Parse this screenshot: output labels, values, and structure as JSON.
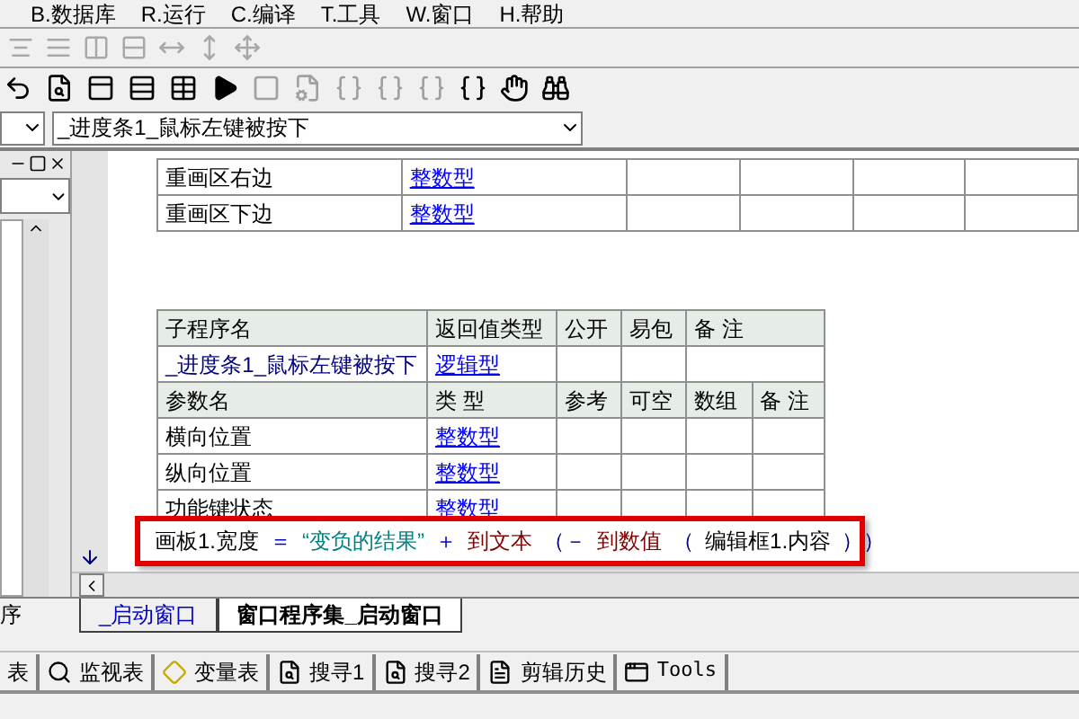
{
  "menu": [
    "B.数据库",
    "R.运行",
    "C.编译",
    "T.工具",
    "W.窗口",
    "H.帮助"
  ],
  "toolbar_1": [
    {
      "disabled": true
    },
    {
      "disabled": true
    },
    {
      "disabled": true
    },
    {
      "disabled": true
    },
    {
      "disabled": true
    },
    {
      "disabled": true
    },
    {
      "disabled": true
    }
  ],
  "toolbar_2": [
    {
      "disabled": false
    },
    {
      "disabled": false
    },
    {
      "disabled": false
    },
    {
      "disabled": false
    },
    {
      "disabled": false
    },
    {
      "disabled": false
    },
    {
      "disabled": true
    },
    {
      "disabled": true
    },
    {
      "disabled": true
    },
    {
      "disabled": true
    },
    {
      "disabled": true
    },
    {
      "disabled": false
    },
    {
      "disabled": false
    },
    {
      "disabled": false
    }
  ],
  "subroutine_combo": {
    "value": "_进度条1_鼠标左键被按下"
  },
  "left_panel": {
    "tab": "序"
  },
  "param_table_top": [
    {
      "name": "重画区右边",
      "type": "整数型"
    },
    {
      "name": "重画区下边",
      "type": "整数型"
    }
  ],
  "sub_table": {
    "header": [
      "子程序名",
      "返回值类型",
      "公开",
      "易包",
      "备 注"
    ],
    "name": "_进度条1_鼠标左键被按下",
    "return_type": "逻辑型",
    "param_header": [
      "参数名",
      "类 型",
      "参考",
      "可空",
      "数组",
      "备 注"
    ],
    "params": [
      {
        "name": "横向位置",
        "type": "整数型"
      },
      {
        "name": "纵向位置",
        "type": "整数型"
      },
      {
        "name": "功能键状态",
        "type": "整数型"
      }
    ]
  },
  "code_line": [
    {
      "kind": "var",
      "text": "画板1.宽度"
    },
    {
      "kind": "op",
      "text": "＝"
    },
    {
      "kind": "string",
      "text": "“变负的结果”"
    },
    {
      "kind": "op",
      "text": "＋"
    },
    {
      "kind": "func",
      "text": "到文本"
    },
    {
      "kind": "paren",
      "text": "（－"
    },
    {
      "kind": "func",
      "text": "到数值"
    },
    {
      "kind": "paren",
      "text": "（"
    },
    {
      "kind": "var",
      "text": "编辑框1.内容"
    },
    {
      "kind": "paren",
      "text": "））"
    }
  ],
  "editor_tabs": [
    {
      "label": "_启动窗口",
      "selected": false
    },
    {
      "label": "窗口程序集_启动窗口",
      "selected": true
    }
  ],
  "dock_tabs": [
    {
      "label": "表"
    },
    {
      "label": "监视表"
    },
    {
      "label": "变量表"
    },
    {
      "label": "搜寻1"
    },
    {
      "label": "搜寻2"
    },
    {
      "label": "剪辑历史"
    },
    {
      "label": "Tools"
    }
  ]
}
